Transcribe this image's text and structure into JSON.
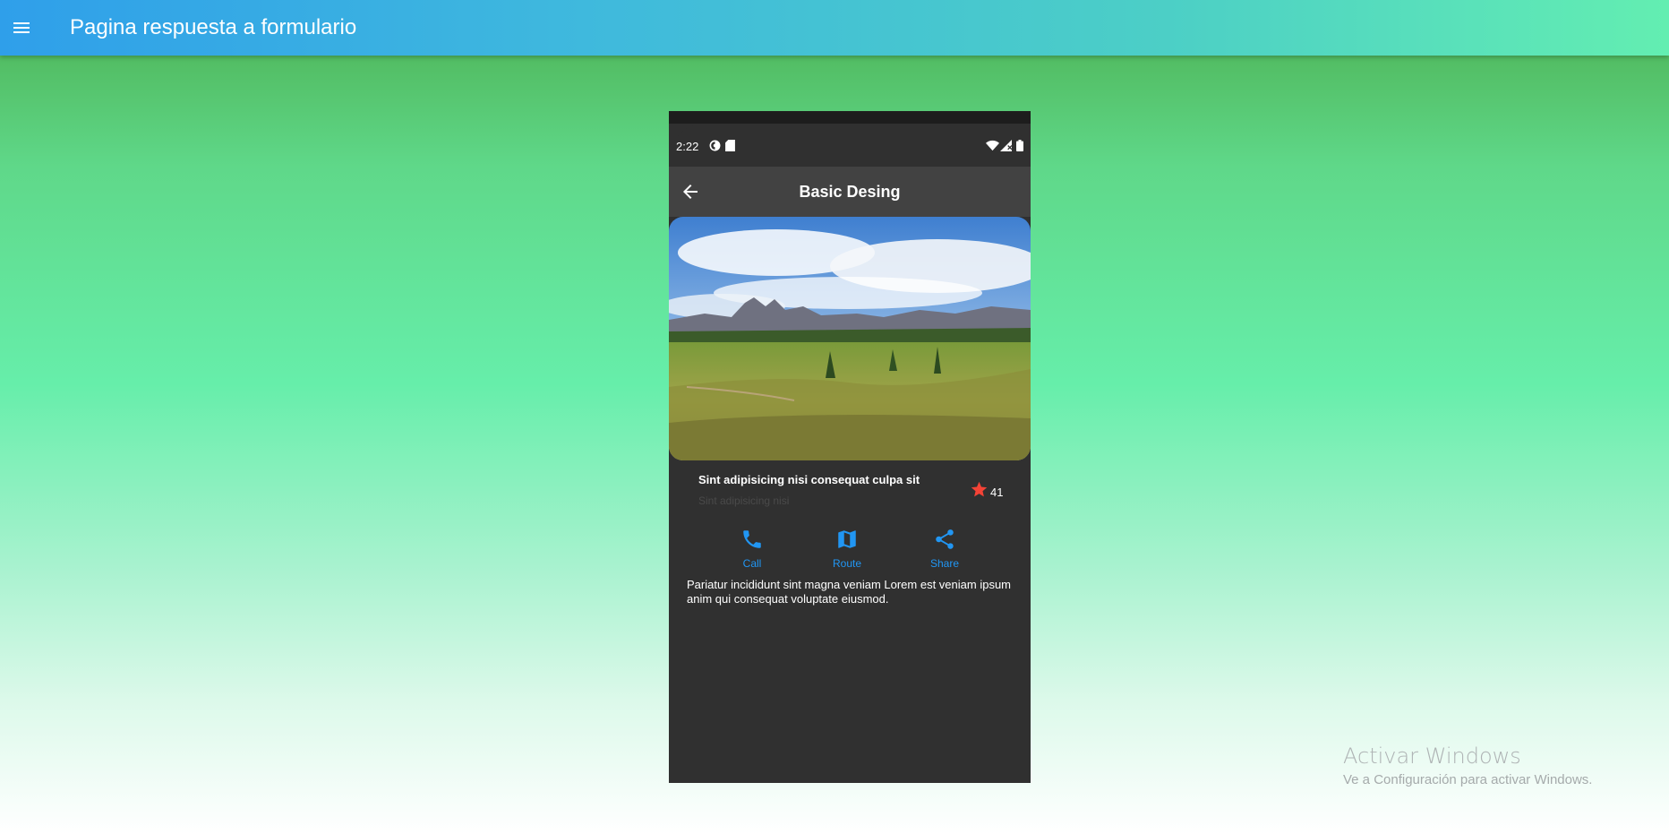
{
  "topbar": {
    "title": "Pagina respuesta a formulario",
    "menu_icon": "hamburger-menu-icon"
  },
  "phone": {
    "status": {
      "time": "2:22"
    },
    "appbar": {
      "title": "Basic Desing",
      "back_icon": "arrow-back-icon"
    },
    "hero_image": "mountain-landscape-photo",
    "item": {
      "title": "Sint adipisicing nisi consequat culpa sit",
      "subtitle": "Sint adipisicing nisi",
      "rating": "41",
      "star_color": "#f44336"
    },
    "actions": [
      {
        "label": "Call",
        "icon": "phone-icon"
      },
      {
        "label": "Route",
        "icon": "map-icon"
      },
      {
        "label": "Share",
        "icon": "share-icon"
      }
    ],
    "accent_color": "#2196f3",
    "description": "Pariatur incididunt sint magna veniam Lorem est veniam ipsum anim qui consequat voluptate eiusmod."
  },
  "watermark": {
    "title": "Activar Windows",
    "subtitle": "Ve a Configuración para activar Windows."
  }
}
